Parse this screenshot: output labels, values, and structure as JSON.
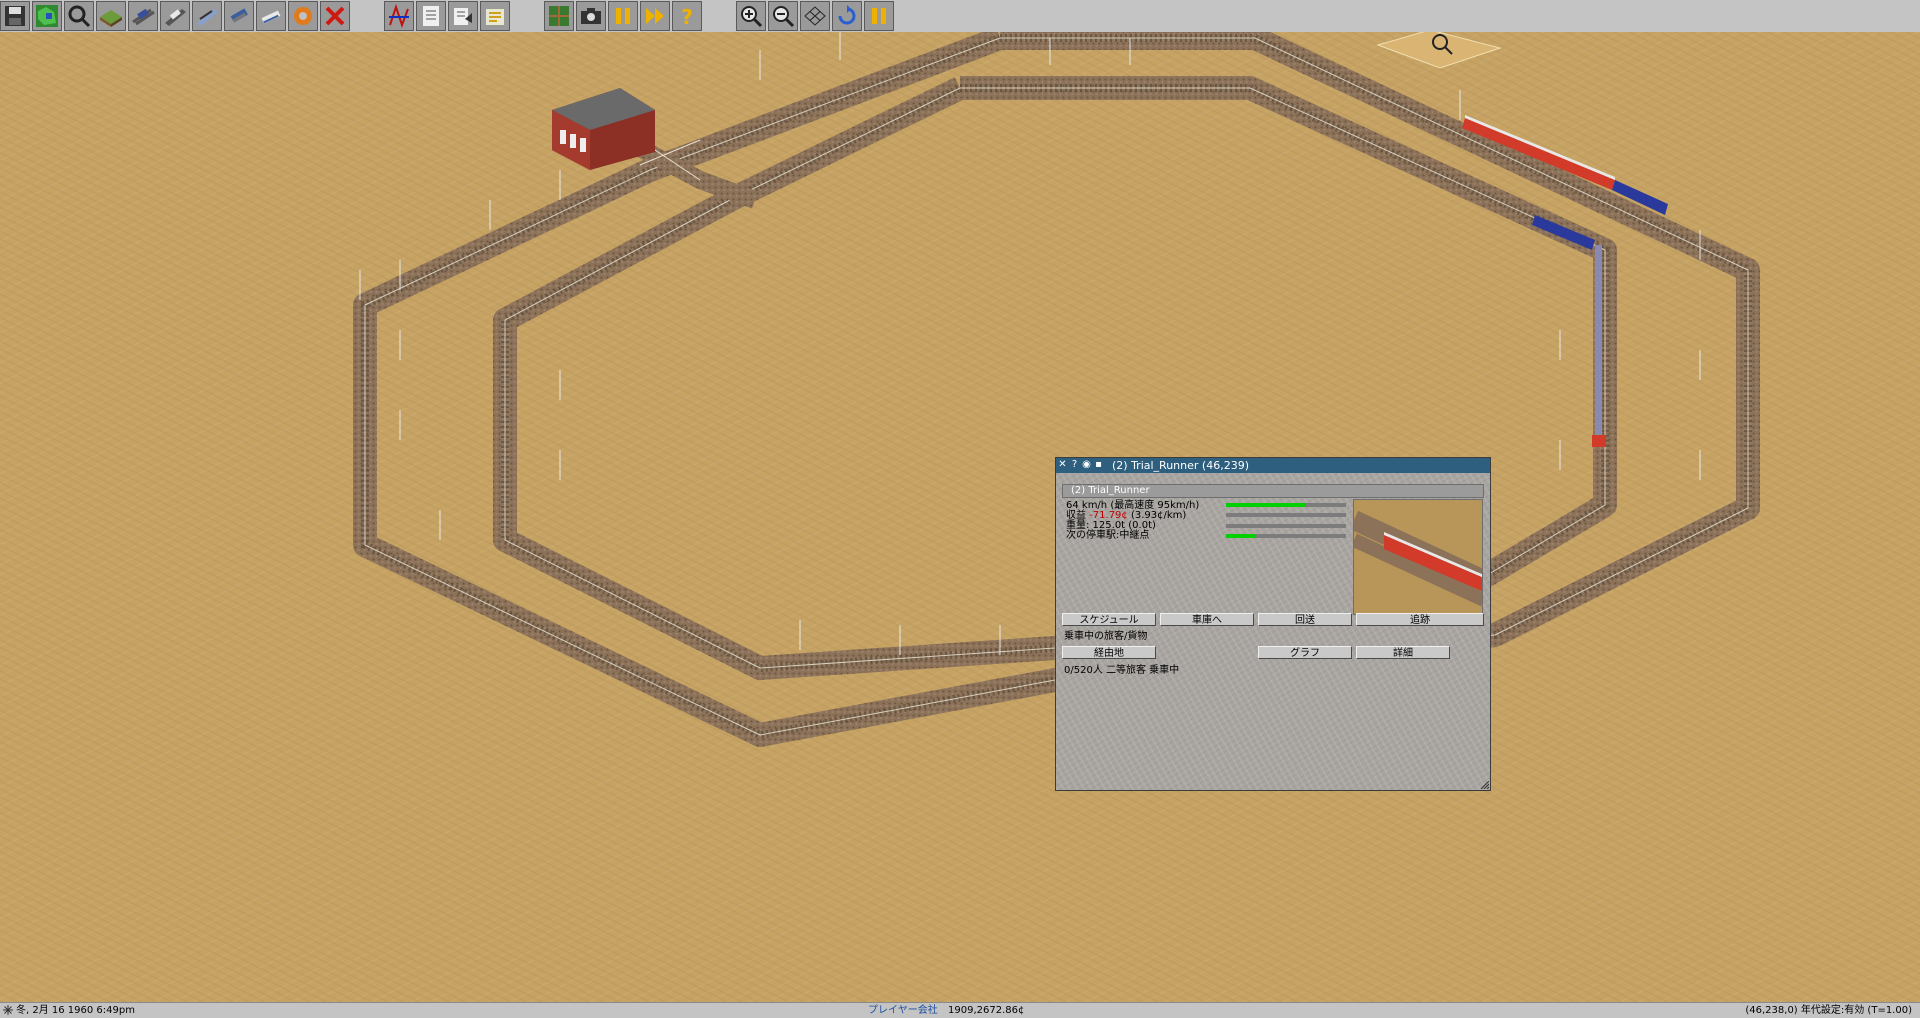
{
  "toolbar": {
    "buttons": [
      {
        "icon": "save-icon"
      },
      {
        "icon": "map-icon"
      },
      {
        "icon": "query-icon"
      },
      {
        "icon": "terrain-icon"
      },
      {
        "icon": "rail-tools-icon"
      },
      {
        "icon": "road-tools-icon"
      },
      {
        "icon": "ship-tools-icon"
      },
      {
        "icon": "air-tools-icon"
      },
      {
        "icon": "monorail-tools-icon"
      },
      {
        "icon": "special-tools-icon"
      },
      {
        "icon": "remove-icon"
      },
      {
        "icon": "line-management-icon"
      },
      {
        "icon": "list-icon"
      },
      {
        "icon": "finance-icon"
      },
      {
        "icon": "settings-icon"
      },
      {
        "icon": "minimap-icon"
      },
      {
        "icon": "screenshot-icon"
      },
      {
        "icon": "pause-icon"
      },
      {
        "icon": "fast-forward-icon"
      },
      {
        "icon": "help-icon"
      },
      {
        "icon": "zoom-in-icon"
      },
      {
        "icon": "zoom-out-icon"
      },
      {
        "icon": "grid-icon"
      },
      {
        "icon": "rotate-icon"
      },
      {
        "icon": "pause-icon-2"
      }
    ]
  },
  "vehicle_window": {
    "title": "(2) Trial_Runner (46,239)",
    "name": "(2) Trial_Runner",
    "speed_line": "64 km/h (最高速度 95km/h)",
    "income_label": "収益",
    "income_value": "-71.79¢",
    "income_per_km": "(3.93¢/km)",
    "weight_line": "重量: 125.0t (0.0t)",
    "next_stop_line": "次の停車駅:中継点",
    "speed_ratio": 0.67,
    "load_ratio": 0.0,
    "weight_ratio": 0.25,
    "buttons": {
      "schedule": "スケジュール",
      "to_depot": "車庫へ",
      "no_load": "回送",
      "follow": "追跡",
      "via": "経由地",
      "graph": "グラフ",
      "details": "詳細"
    },
    "cargo_header": "乗車中の旅客/貨物",
    "cargo_line": "0/520人 二等旅客 乗車中"
  },
  "status_bar": {
    "date": "冬, 2月 16 1960  6:49pm",
    "player": "プレイヤー会社",
    "money": "1909,2672.86¢",
    "coords": "(46,238,0) 年代設定:有効 (T=1.00)"
  },
  "colors": {
    "desert": "#c7a363",
    "titlebar": "#2e5f7e",
    "train_red": "#d23a2a",
    "train_blue": "#2a3a9c"
  }
}
